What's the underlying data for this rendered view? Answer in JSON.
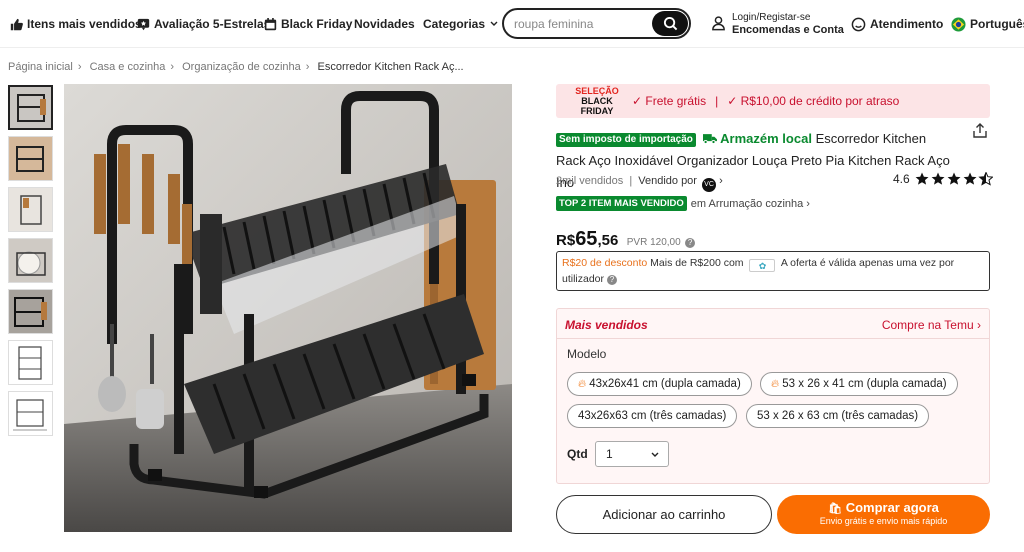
{
  "nav": {
    "best_sellers": "Itens mais vendidos",
    "five_star": "Avaliação 5-Estrelas",
    "black_friday": "Black Friday",
    "new": "Novidades",
    "categories": "Categorias"
  },
  "search": {
    "placeholder": "roupa feminina"
  },
  "account": {
    "line1": "Login/Registar-se",
    "line2": "Encomendas e Conta"
  },
  "support": "Atendimento",
  "language": "Português",
  "breadcrumb": [
    "Página inicial",
    "Casa e cozinha",
    "Organização de cozinha",
    "Escorredor Kitchen Rack Aç..."
  ],
  "banner": {
    "logo_line1": "SELEÇÃO",
    "logo_line2": "BLACK FRIDAY",
    "free_shipping": "✓ Frete grátis",
    "sep": "|",
    "credit": "✓ R$10,00 de crédito por atraso"
  },
  "product": {
    "no_import_tax": "Sem imposto de importação",
    "local_warehouse": "Armazém local",
    "title": "Escorredor Kitchen Rack Aço Inoxidável Organizador Louça Preto Pia Kitchen Rack Aço Ino",
    "sold": "2mil vendidos",
    "sold_by": "Vendido por",
    "seller_icon": "VC",
    "rating": "4.6",
    "stars": 4.6,
    "top_badge": "TOP 2 ITEM MAIS VENDIDO",
    "top_category": "em Arrumação cozinha"
  },
  "price": {
    "currency": "R$",
    "int": "65",
    "dec": ",56",
    "pvr": "PVR 120,00"
  },
  "promo": {
    "discount": "R$20 de desconto",
    "condition": "Mais de R$200 com",
    "note": "A oferta é válida apenas uma vez por utilizador"
  },
  "mais": {
    "title": "Mais vendidos",
    "link": "Compre na Temu",
    "modelo_label": "Modelo",
    "options": [
      "43x26x41 cm (dupla camada)",
      "53 x 26 x 41 cm (dupla camada)",
      "43x26x63 cm (três camadas)",
      "53 x 26 x 63 cm (três camadas)"
    ],
    "qtd_label": "Qtd",
    "qtd_value": "1"
  },
  "buttons": {
    "add_cart": "Adicionar ao carrinho",
    "buy_now": "Comprar agora",
    "buy_sub": "Envio grátis e envio mais rápido"
  },
  "colors": {
    "accent": "#fa6d02",
    "red": "#c8102e",
    "green": "#0a8a2f"
  }
}
